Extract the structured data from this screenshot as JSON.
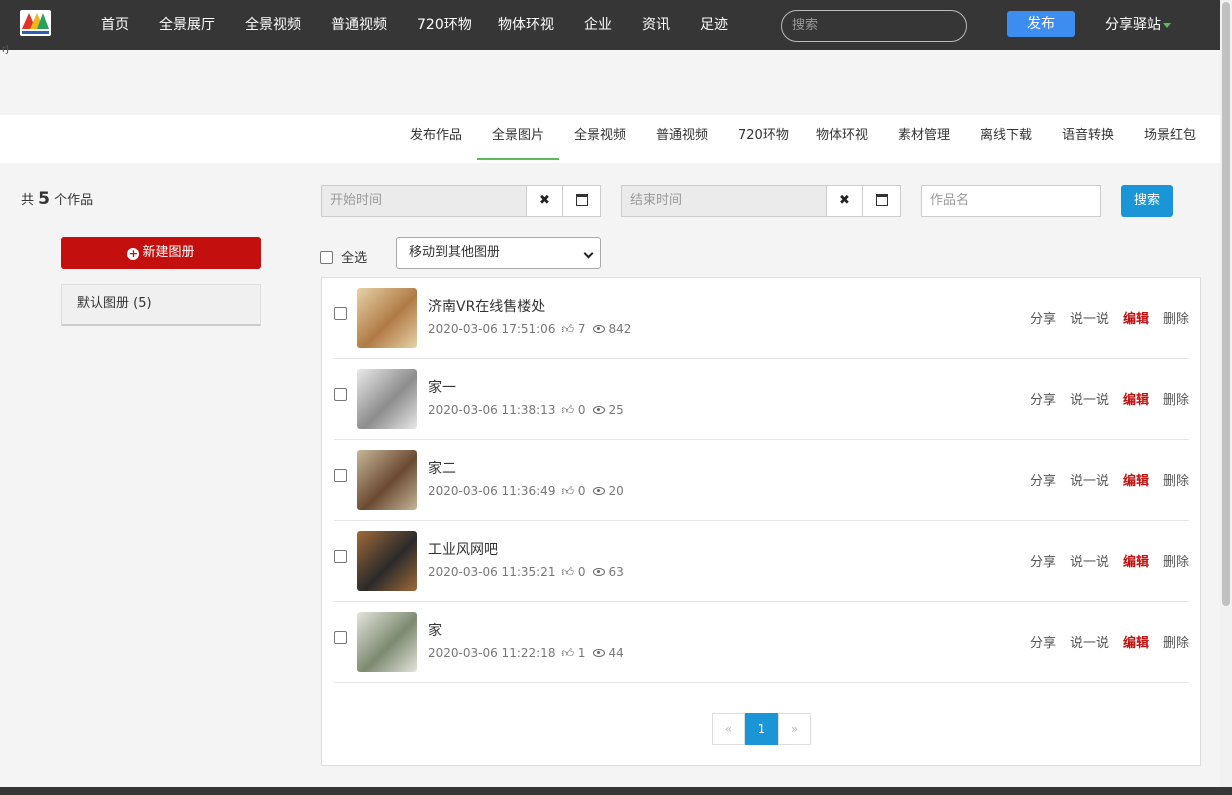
{
  "nav": {
    "items": [
      "首页",
      "全景展厅",
      "全景视频",
      "普通视频",
      "720环物",
      "物体环视",
      "企业",
      "资讯",
      "足迹"
    ],
    "search_placeholder": "搜索",
    "publish_label": "发布",
    "user_label": "分享驿站"
  },
  "subtabs": {
    "items": [
      "发布作品",
      "全景图片",
      "全景视频",
      "普通视频",
      "720环物",
      "物体环视",
      "素材管理",
      "离线下载",
      "语音转换",
      "场景红包"
    ],
    "active": "全景图片"
  },
  "sidebar": {
    "count_prefix": "共",
    "count_value": "5",
    "count_suffix": "个作品",
    "new_album_label": "新建图册",
    "albums": [
      "默认图册 (5)"
    ]
  },
  "filters": {
    "start_placeholder": "开始时间",
    "end_placeholder": "结束时间",
    "name_placeholder": "作品名",
    "clear_glyph": "✖",
    "search_label": "搜索",
    "select_all_label": "全选",
    "move_label": "移动到其他图册"
  },
  "works": [
    {
      "title": "济南VR在线售楼处",
      "date": "2020-03-06 17:51:06",
      "likes": "7",
      "views": "842",
      "colors": [
        "#b07a45",
        "#e7d2a8"
      ]
    },
    {
      "title": "家一",
      "date": "2020-03-06 11:38:13",
      "likes": "0",
      "views": "25",
      "colors": [
        "#8c8c8c",
        "#e9e9e9"
      ]
    },
    {
      "title": "家二",
      "date": "2020-03-06 11:36:49",
      "likes": "0",
      "views": "20",
      "colors": [
        "#6a4a32",
        "#c7b59a"
      ]
    },
    {
      "title": "工业风网吧",
      "date": "2020-03-06 11:35:21",
      "likes": "0",
      "views": "63",
      "colors": [
        "#2a2a2a",
        "#a06a3a"
      ]
    },
    {
      "title": "家",
      "date": "2020-03-06 11:22:18",
      "likes": "1",
      "views": "44",
      "colors": [
        "#7c8a70",
        "#e4e4dc"
      ]
    }
  ],
  "actions": {
    "share": "分享",
    "comment": "说一说",
    "edit": "编辑",
    "delete": "删除"
  },
  "pagination": {
    "prev": "«",
    "current": "1",
    "next": "»"
  },
  "stray_text": "rJ"
}
